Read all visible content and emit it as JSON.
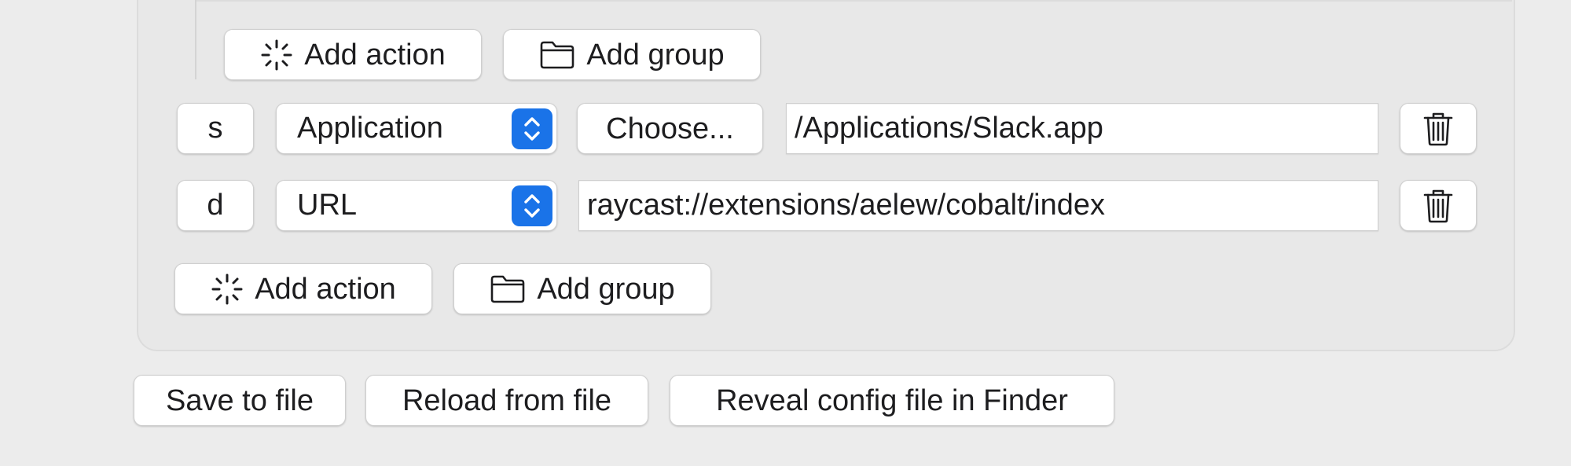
{
  "nested_group": {
    "add_action_label": "Add action",
    "add_group_label": "Add group"
  },
  "rows": [
    {
      "key": "s",
      "type": "Application",
      "choose_label": "Choose...",
      "value": "/Applications/Slack.app"
    },
    {
      "key": "d",
      "type": "URL",
      "value": "raycast://extensions/aelew/cobalt/index"
    }
  ],
  "root_group": {
    "add_action_label": "Add action",
    "add_group_label": "Add group"
  },
  "footer": {
    "save_label": "Save to file",
    "reload_label": "Reload from file",
    "reveal_label": "Reveal config file in Finder"
  },
  "colors": {
    "accent": "#1a73e8",
    "background": "#ececec",
    "control_bg": "#ffffff"
  },
  "icons": {
    "add_action": "sparkle-loader-icon",
    "add_group": "folder-icon",
    "delete": "trash-icon",
    "select_stepper": "chevron-up-down-icon"
  }
}
